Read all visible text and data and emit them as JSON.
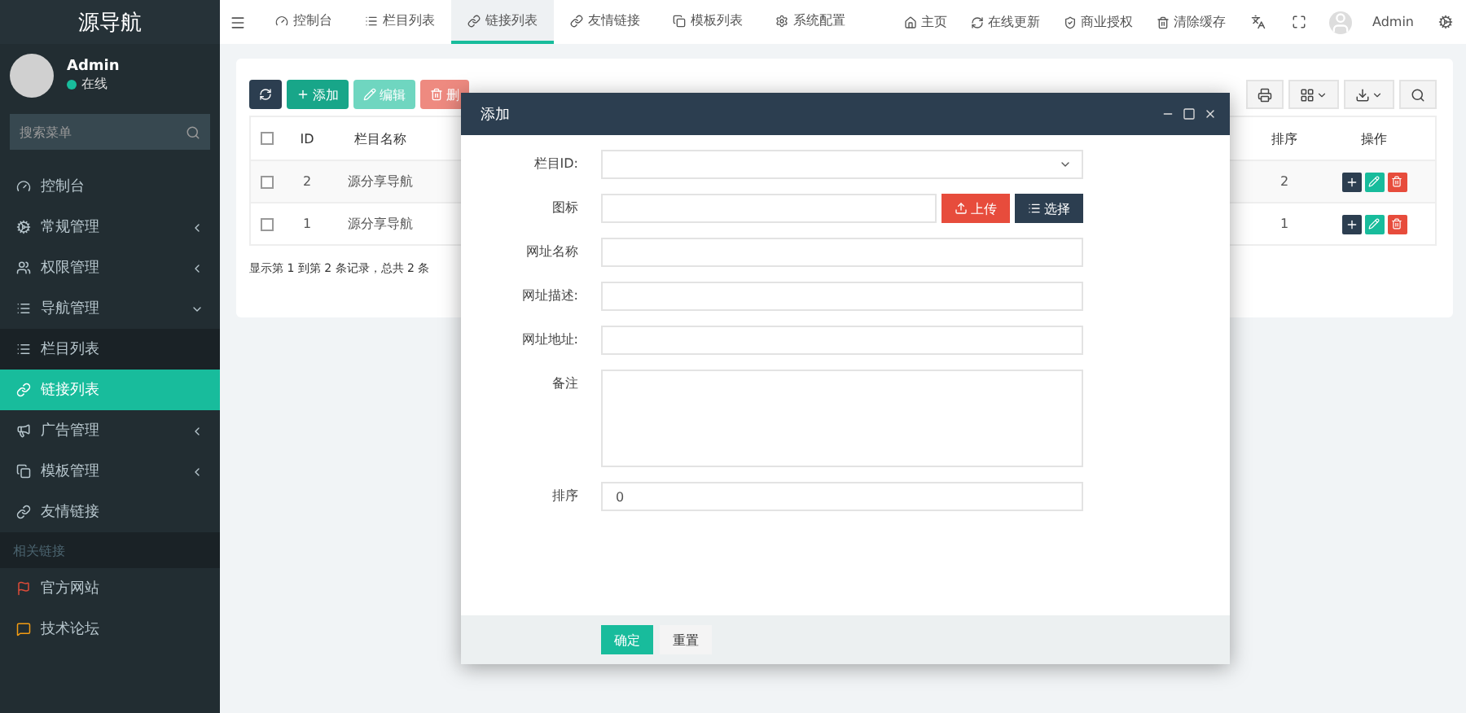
{
  "sidebar": {
    "brand": "源导航",
    "user": {
      "name": "Admin",
      "status": "在线"
    },
    "search": {
      "placeholder": "搜索菜单"
    },
    "items": [
      {
        "kind": "item",
        "label": "控制台",
        "selected": false
      },
      {
        "kind": "group",
        "label": "常规管理",
        "expanded": false,
        "selected": false
      },
      {
        "kind": "group",
        "label": "权限管理",
        "expanded": false,
        "selected": false
      },
      {
        "kind": "group",
        "label": "导航管理",
        "expanded": true,
        "selected": false,
        "children": [
          {
            "label": "栏目列表",
            "selected": false
          },
          {
            "label": "链接列表",
            "selected": true
          }
        ]
      },
      {
        "kind": "group",
        "label": "广告管理",
        "expanded": false,
        "selected": false
      },
      {
        "kind": "group",
        "label": "模板管理",
        "expanded": false,
        "selected": false
      },
      {
        "kind": "item",
        "label": "友情链接",
        "selected": false
      },
      {
        "kind": "header",
        "label": "相关链接"
      },
      {
        "kind": "item",
        "label": "官方网站",
        "selected": false
      },
      {
        "kind": "item",
        "label": "技术论坛",
        "selected": false
      }
    ]
  },
  "tabs": [
    {
      "label": "控制台",
      "selected": false
    },
    {
      "label": "栏目列表",
      "selected": false
    },
    {
      "label": "链接列表",
      "selected": true
    },
    {
      "label": "友情链接",
      "selected": false
    },
    {
      "label": "模板列表",
      "selected": false
    },
    {
      "label": "系统配置",
      "selected": false
    }
  ],
  "top_links": [
    "主页",
    "在线更新",
    "商业授权",
    "清除缓存"
  ],
  "top_user": "Admin",
  "toolbar": {
    "buttons": [
      {
        "kind": "refresh"
      },
      {
        "kind": "add",
        "label": "添加"
      },
      {
        "kind": "edit",
        "label": "编辑"
      },
      {
        "kind": "delete",
        "label": "删"
      }
    ]
  },
  "table": {
    "all_checked": false,
    "columns": [
      "ID",
      "栏目名称",
      "排序",
      "操作"
    ],
    "rows": [
      {
        "id": "2",
        "name": "源分享导航",
        "sort": "2",
        "checked": false
      },
      {
        "id": "1",
        "name": "源分享导航",
        "sort": "1",
        "checked": false
      }
    ],
    "summary": "显示第 1 到第 2 条记录，总共 2 条"
  },
  "dialog": {
    "title": "添加",
    "fields": [
      {
        "kind": "select",
        "label": "栏目ID:"
      },
      {
        "kind": "upload",
        "label": "图标",
        "buttons": [
          "上传",
          "选择"
        ]
      },
      {
        "kind": "text",
        "label": "网址名称"
      },
      {
        "kind": "text",
        "label": "网址描述:"
      },
      {
        "kind": "text",
        "label": "网址地址:"
      },
      {
        "kind": "textarea",
        "label": "备注"
      },
      {
        "kind": "text",
        "label": "排序",
        "value": "0"
      }
    ],
    "buttons": [
      "确定",
      "重置"
    ]
  }
}
